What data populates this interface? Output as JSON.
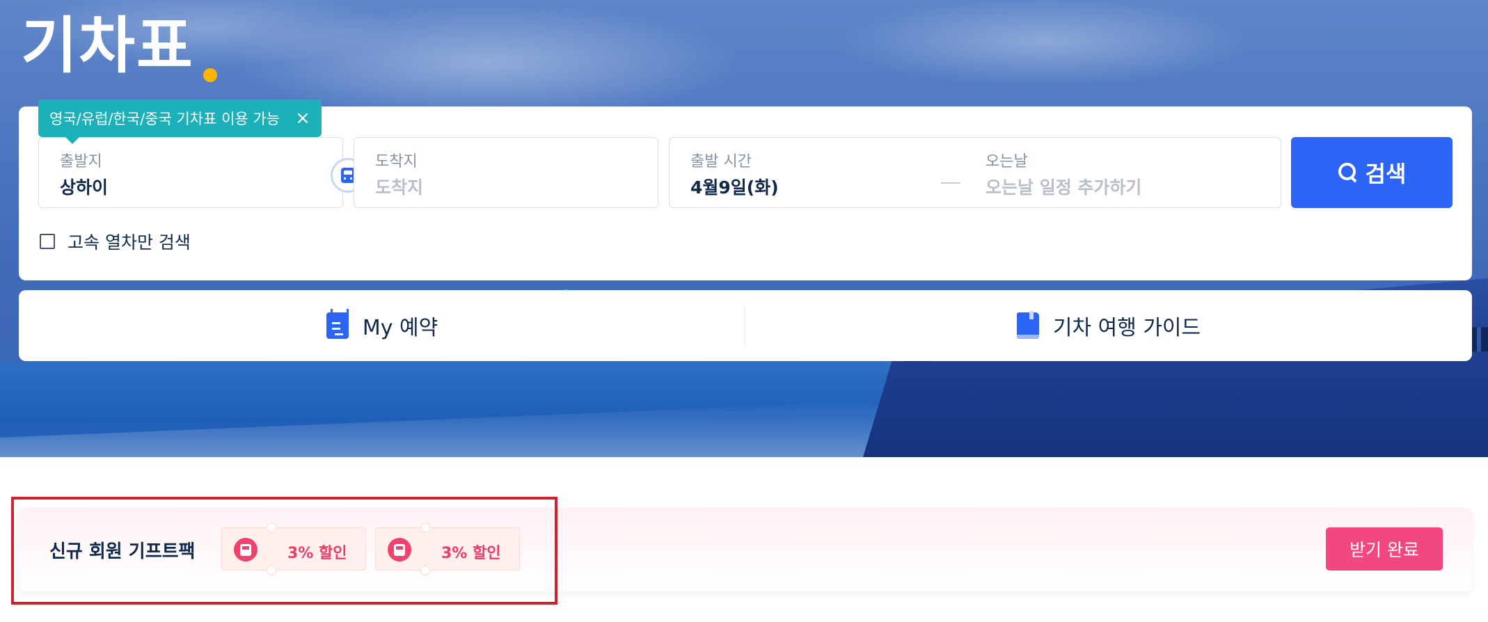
{
  "hero": {
    "title": "기차표"
  },
  "tooltip": {
    "text": "영국/유럽/한국/중국 기차표 이용 가능",
    "close_icon": "close-icon"
  },
  "search": {
    "departure": {
      "label": "출발지",
      "value": "상하이"
    },
    "arrival": {
      "label": "도착지",
      "placeholder": "도착지"
    },
    "depart_time": {
      "label": "출발 시간",
      "value": "4월9일(화)"
    },
    "return_date": {
      "label": "오는날",
      "placeholder": "오는날 일정 추가하기"
    },
    "button_label": "검색",
    "highspeed_label": "고속 열차만 검색",
    "highspeed_checked": false
  },
  "quick_links": {
    "my_booking": "My 예약",
    "travel_guide": "기차 여행 가이드"
  },
  "gift": {
    "title": "신규 회원 기프트팩",
    "coupons": [
      {
        "text": "3% 할인"
      },
      {
        "text": "3% 할인"
      }
    ],
    "button_label": "받기 완료"
  },
  "colors": {
    "primary": "#2c64f6",
    "tooltip": "#1cb0b8",
    "accent_dot": "#ffb400",
    "gift_button": "#f3487f",
    "coupon_icon": "#f0426f",
    "highlight": "#d3202e"
  }
}
